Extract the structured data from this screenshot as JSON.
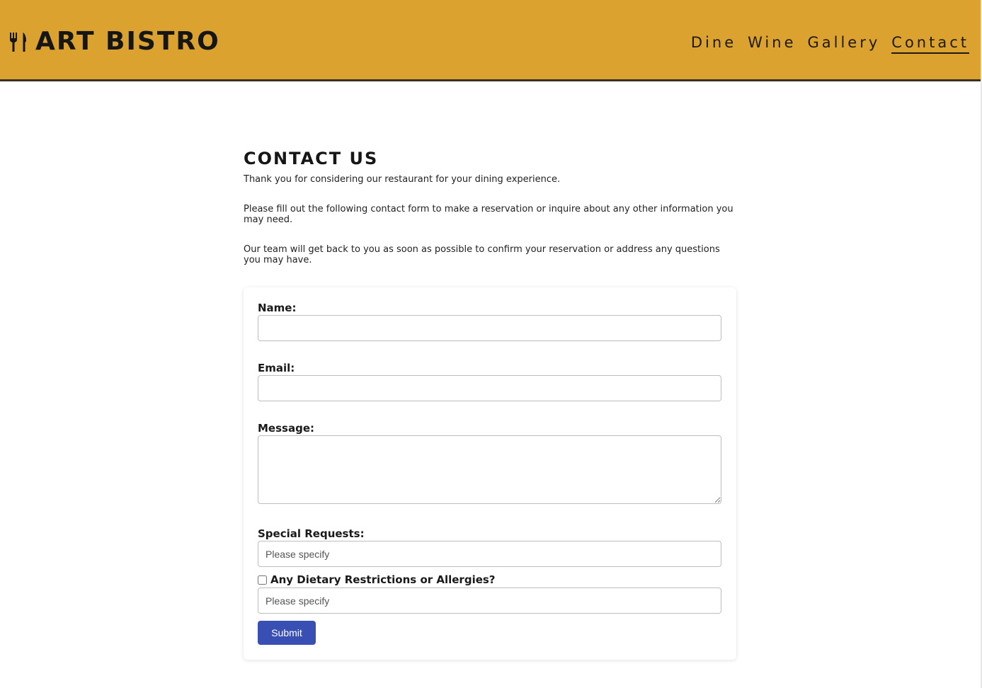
{
  "header": {
    "brand_icon": "fork-knife-icon",
    "brand_title": "ART BISTRO",
    "bg_color": "#dba230",
    "nav": [
      {
        "label": "Dine"
      },
      {
        "label": "Wine"
      },
      {
        "label": "Gallery"
      },
      {
        "label": "Contact",
        "active": true
      }
    ]
  },
  "main": {
    "title": "CONTACT US",
    "paragraphs": [
      "Thank you for considering our restaurant for your dining experience.",
      "Please fill out the following contact form to make a reservation or inquire about any other information you may need.",
      "Our team will get back to you as soon as possible to confirm your reservation or address any questions you may have."
    ]
  },
  "form": {
    "name_label": "Name:",
    "name_value": "",
    "email_label": "Email:",
    "email_value": "",
    "message_label": "Message:",
    "message_value": "",
    "special_requests_label": "Special Requests:",
    "special_requests_placeholder": "Please specify",
    "dietary_label": "Any Dietary Restrictions or Allergies?",
    "dietary_checked": false,
    "dietary_placeholder": "Please specify",
    "submit_label": "Submit",
    "submit_color": "#3a4fb4"
  }
}
